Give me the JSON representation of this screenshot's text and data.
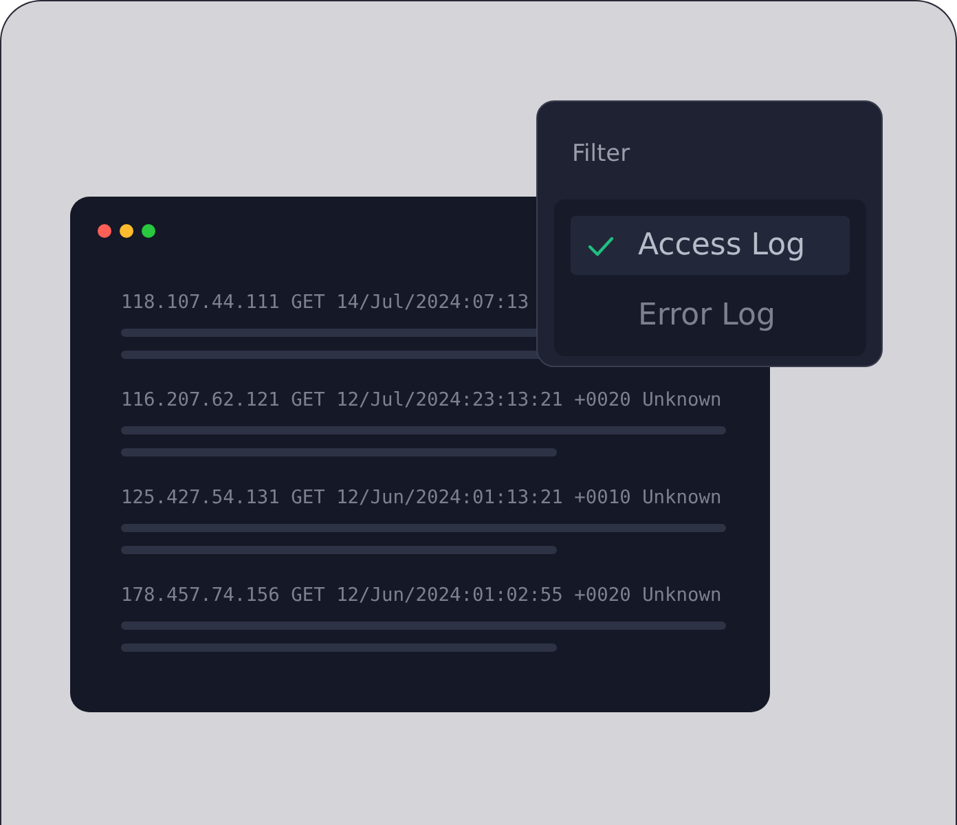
{
  "log_window": {
    "entries": [
      {
        "text": "118.107.44.111 GET 14/Jul/2024:07:13"
      },
      {
        "text": "116.207.62.121 GET 12/Jul/2024:23:13:21 +0020 Unknown"
      },
      {
        "text": "125.427.54.131 GET 12/Jun/2024:01:13:21 +0010 Unknown"
      },
      {
        "text": "178.457.74.156 GET 12/Jun/2024:01:02:55 +0020 Unknown"
      }
    ]
  },
  "filter_menu": {
    "title": "Filter",
    "options": [
      {
        "label": "Access Log",
        "selected": true
      },
      {
        "label": "Error Log",
        "selected": false
      }
    ]
  }
}
